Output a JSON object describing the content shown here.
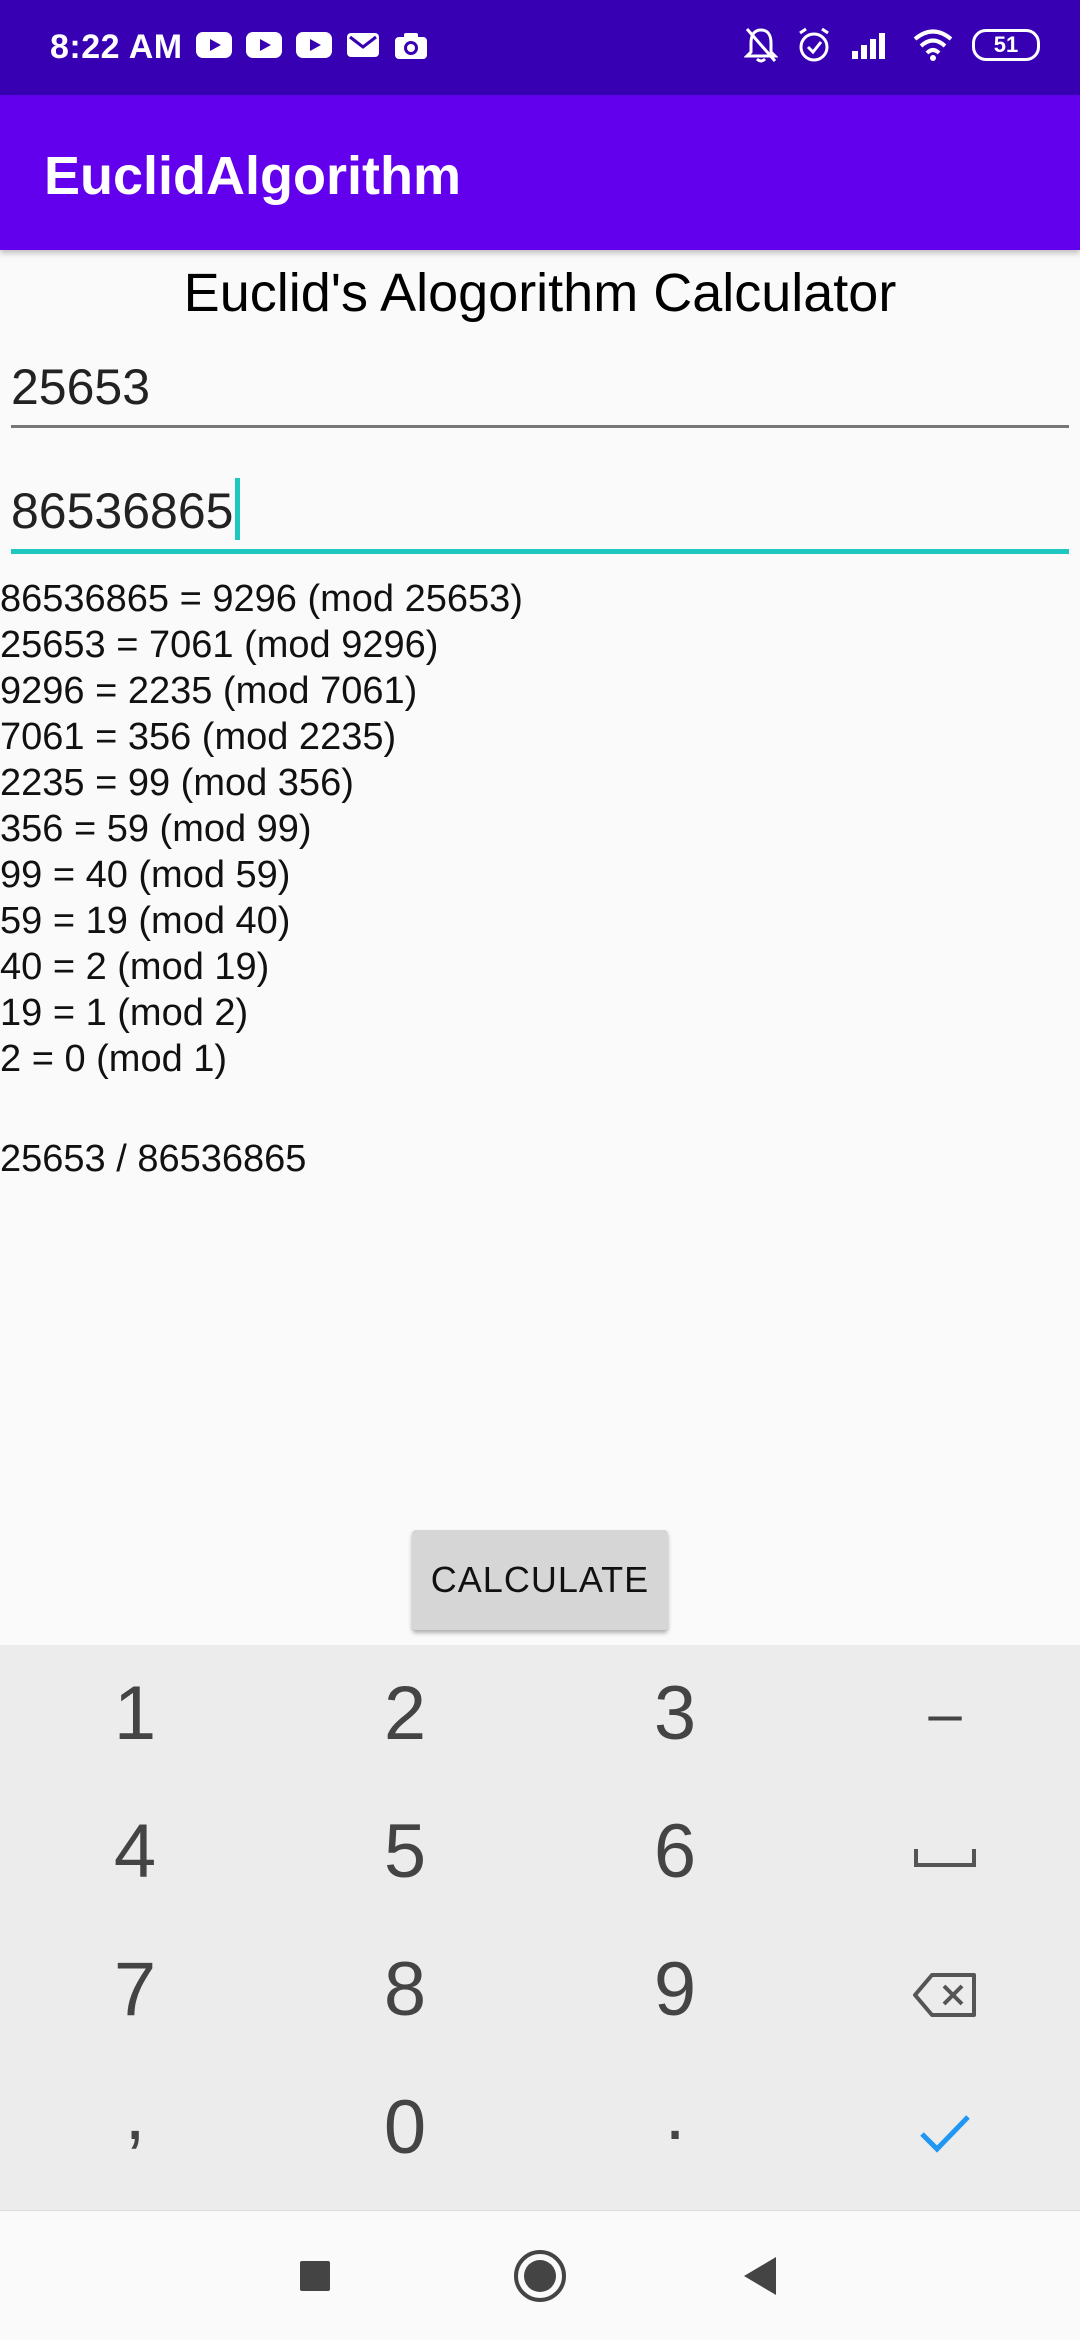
{
  "status_bar": {
    "time": "8:22 AM",
    "battery": "51",
    "notification_icons": [
      "youtube-icon",
      "youtube-icon",
      "youtube-icon",
      "gmail-icon",
      "camera-icon"
    ],
    "system_icons": [
      "bell-off-icon",
      "alarm-icon",
      "signal-icon",
      "wifi-icon",
      "battery-icon"
    ]
  },
  "app_bar": {
    "title": "EuclidAlgorithm"
  },
  "page_title": "Euclid's Alogorithm Calculator",
  "inputs": {
    "first_value": "25653",
    "second_value": "86536865"
  },
  "steps": [
    "86536865 = 9296 (mod 25653)",
    "25653 = 7061 (mod 9296)",
    "9296 = 2235 (mod 7061)",
    "7061 = 356 (mod 2235)",
    "2235 = 99 (mod 356)",
    "356 = 59 (mod 99)",
    "99 = 40 (mod 59)",
    "59 = 19 (mod 40)",
    "40 = 2 (mod 19)",
    "19 = 1 (mod 2)",
    "2 = 0 (mod 1)"
  ],
  "result": "25653 / 86536865",
  "calculate_label": "CALCULATE",
  "keyboard": {
    "keys": [
      "1",
      "2",
      "3",
      "–",
      "4",
      "5",
      "6",
      "7",
      "8",
      "9",
      ",",
      "0",
      "."
    ],
    "accent": "#2196f3"
  },
  "colors": {
    "status_bar": "#3700b3",
    "app_bar": "#6200ee",
    "focus_underline": "#1ec8c0"
  }
}
